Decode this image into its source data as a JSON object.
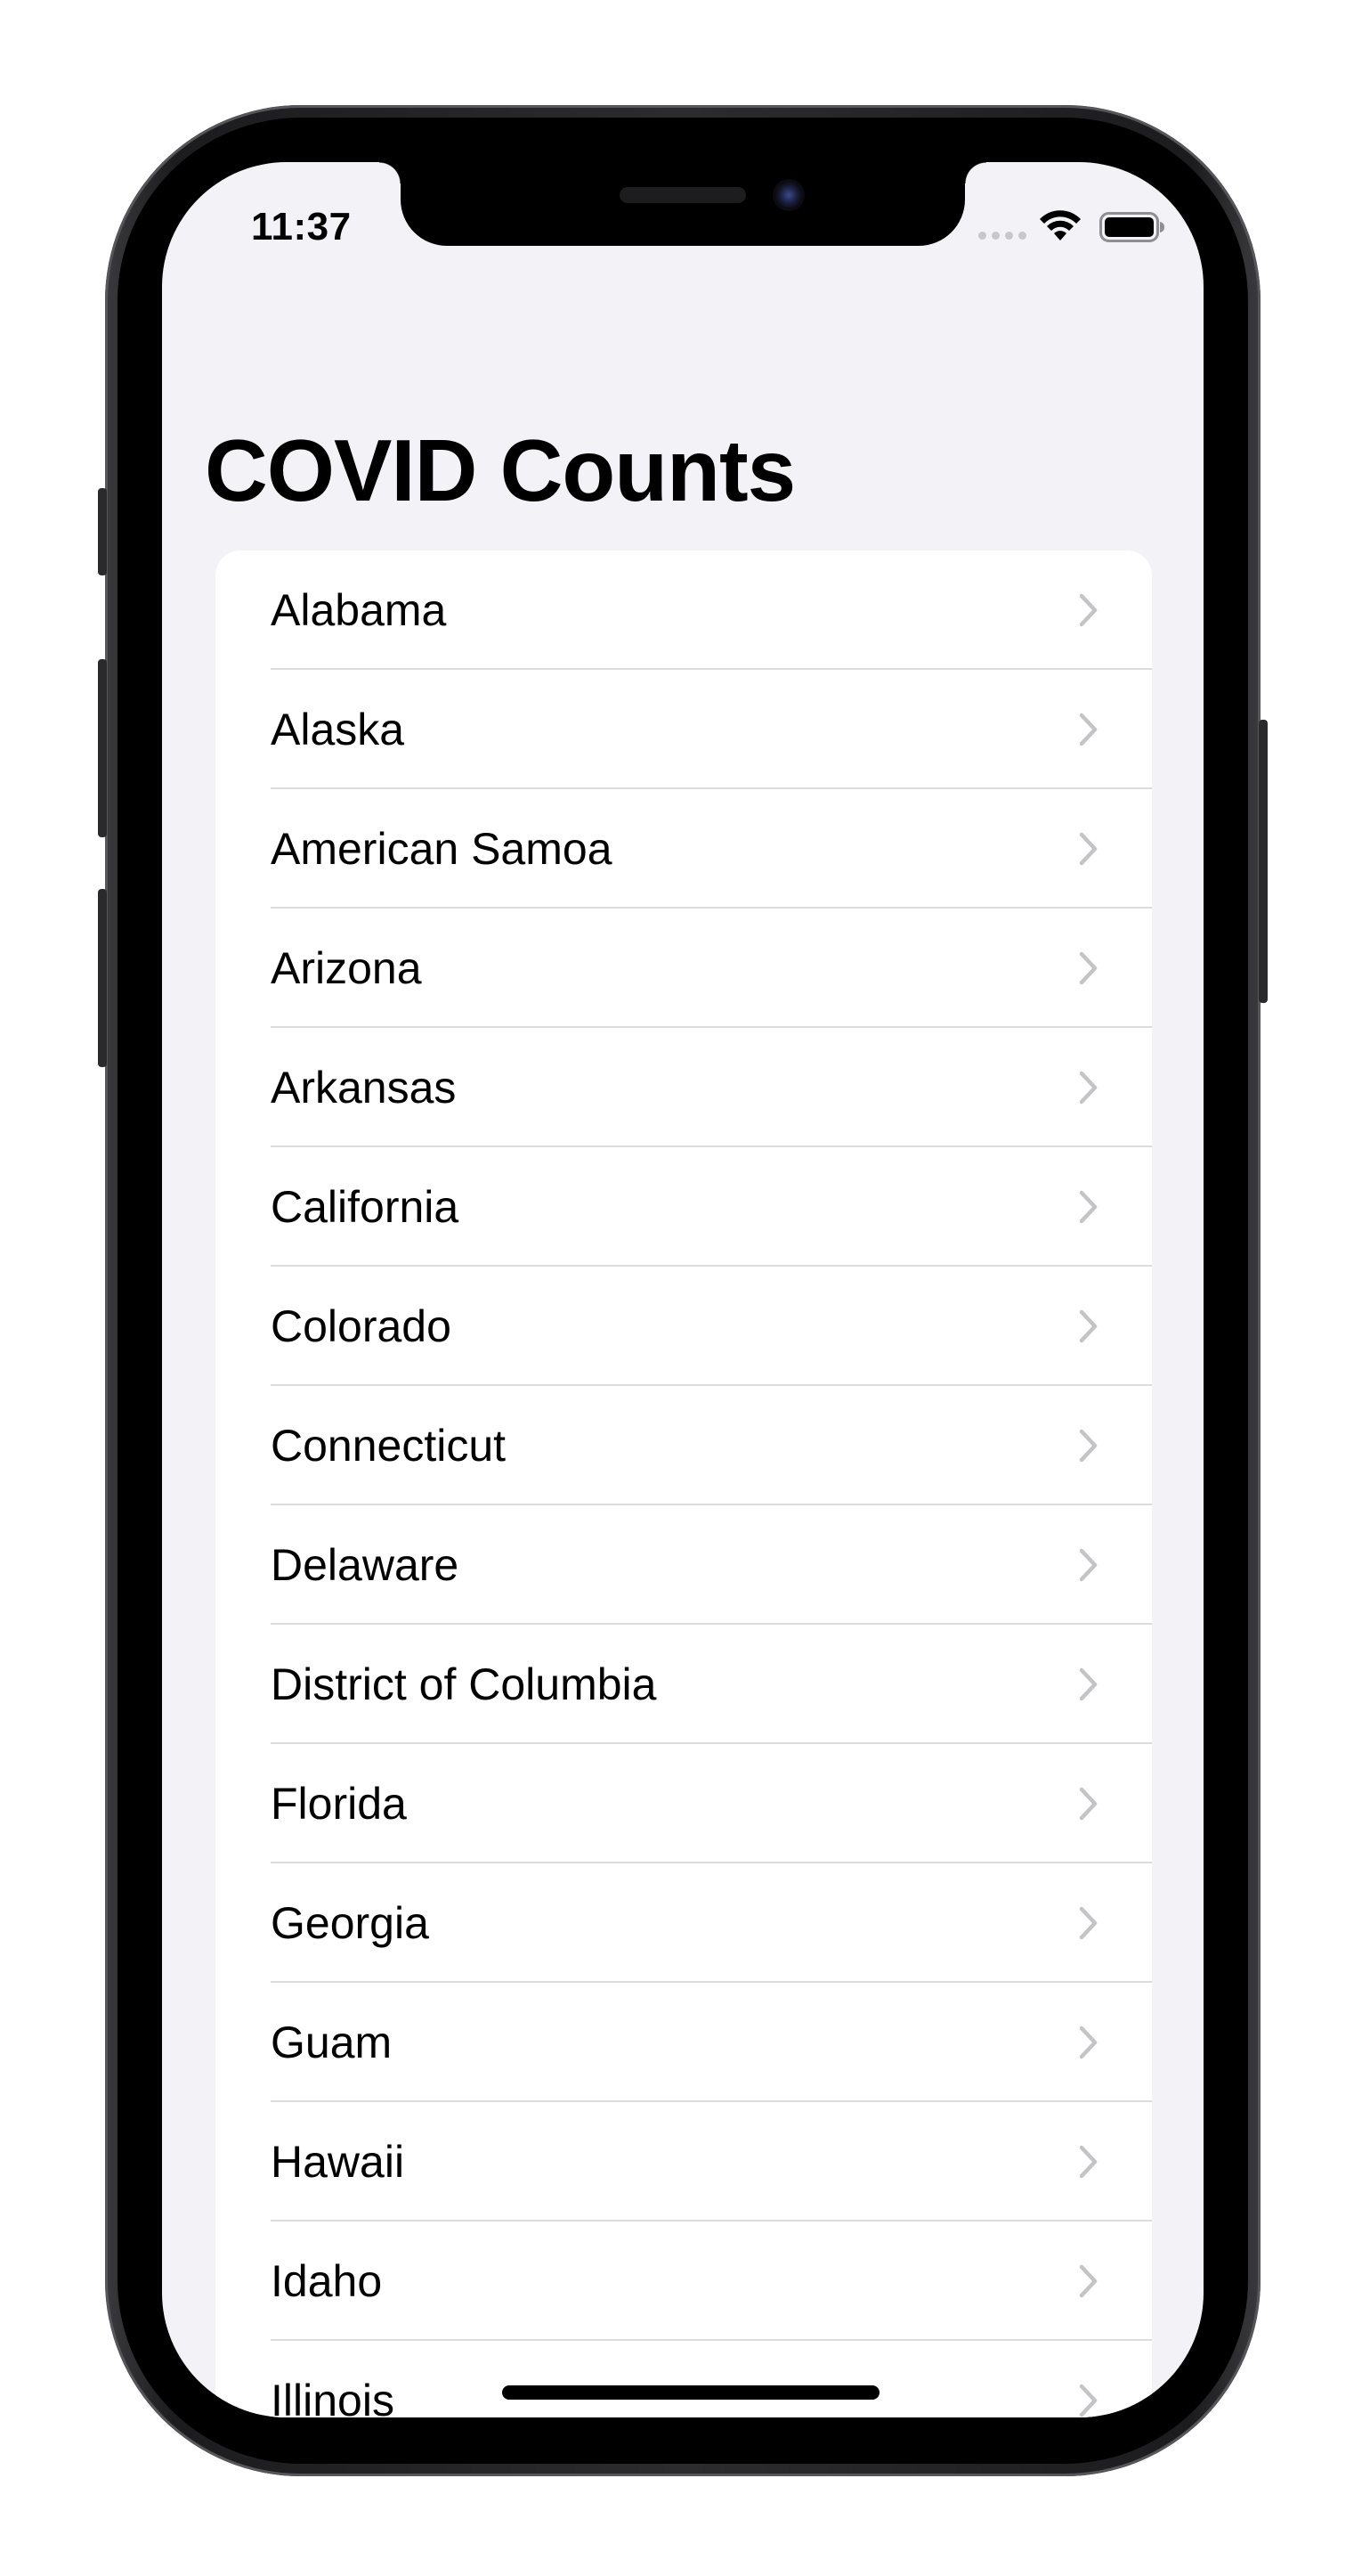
{
  "status_bar": {
    "time": "11:37",
    "wifi_icon": "wifi-icon",
    "battery_icon": "battery-icon"
  },
  "header": {
    "title": "COVID Counts"
  },
  "list": {
    "items": [
      {
        "label": "Alabama"
      },
      {
        "label": "Alaska"
      },
      {
        "label": "American Samoa"
      },
      {
        "label": "Arizona"
      },
      {
        "label": "Arkansas"
      },
      {
        "label": "California"
      },
      {
        "label": "Colorado"
      },
      {
        "label": "Connecticut"
      },
      {
        "label": "Delaware"
      },
      {
        "label": "District of Columbia"
      },
      {
        "label": "Florida"
      },
      {
        "label": "Georgia"
      },
      {
        "label": "Guam"
      },
      {
        "label": "Hawaii"
      },
      {
        "label": "Idaho"
      },
      {
        "label": "Illinois"
      }
    ],
    "accessory_icon": "chevron-right-icon"
  },
  "colors": {
    "background": "#f2f2f7",
    "cell": "#ffffff",
    "separator": "#dcdce0",
    "chevron": "#c4c4c7",
    "text": "#000000"
  }
}
